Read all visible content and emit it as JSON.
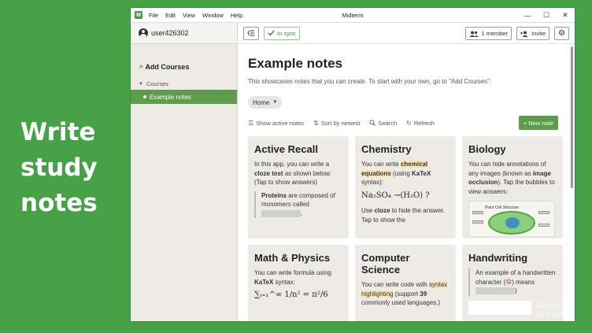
{
  "promo": {
    "line1": "Write",
    "line2": "study",
    "line3": "notes"
  },
  "window": {
    "title": "Midterm",
    "menu": [
      "File",
      "Edit",
      "View",
      "Window",
      "Help"
    ],
    "controls": {
      "minimize": "—",
      "maximize": "☐",
      "close": "✕"
    }
  },
  "sidebar": {
    "username": "user426302",
    "add_courses": "Add Courses",
    "courses_label": "Courses",
    "active_course": "Example notes"
  },
  "toolbar": {
    "sync_label": "In sync",
    "members_label": "1 member",
    "invite_label": "Invite"
  },
  "page": {
    "title": "Example notes",
    "subtitle": "This showcases notes that you can create. To start with your own, go to \"Add Courses\".",
    "home_chip": "Home"
  },
  "actions": {
    "show_active": "Show active notes",
    "sort": "Sort by newest",
    "search": "Search",
    "refresh": "Refresh",
    "new_note": "+ New note"
  },
  "cards": {
    "recall": {
      "title": "Active Recall",
      "t1": "In this app, you can write a ",
      "t2": "cloze test",
      "t3": " as shown below: (Tap to show answers)",
      "q1": "Proteins",
      "q2": " are composed of monomers called "
    },
    "chem": {
      "title": "Chemistry",
      "t1": "You can write ",
      "t2": "chemical equations",
      "t3": " (using ",
      "t4": "KaTeX",
      "t5": " syntax):",
      "formula": "Na₂SO₄ →(H₂O) ?",
      "t6": "Use ",
      "t7": "cloze",
      "t8": " to hide the answer. Tap to show the"
    },
    "bio": {
      "title": "Biology",
      "t1": "You can hide annotations of any images (known as ",
      "t2": "image occlusion",
      "t3": "). Tap the bubbles to view answers:",
      "img_caption": "Plant Cell Structure"
    },
    "math": {
      "title": "Math & Physics",
      "t1": "You can write formula using ",
      "t2": "KaTeX",
      "t3": " syntax:",
      "formula": "∑ᵢ₌₁^∞ 1/n² = π²/6"
    },
    "cs": {
      "title": "Computer Science",
      "t1": "You can write code with ",
      "t2": "syntax highlighting",
      "t3": " (support ",
      "t4": "39",
      "t5": " commonly used languages.)"
    },
    "hw": {
      "title": "Handwriting",
      "t1": "An example of a handwritten character (",
      "char": "伞",
      "t2": ") means "
    }
  },
  "watermark": {
    "line1": "Activate W",
    "line2": "Go to Settin"
  },
  "colors": {
    "background": "#46a147",
    "accent": "#5c9c4a",
    "highlight": "#fbe5b6"
  }
}
